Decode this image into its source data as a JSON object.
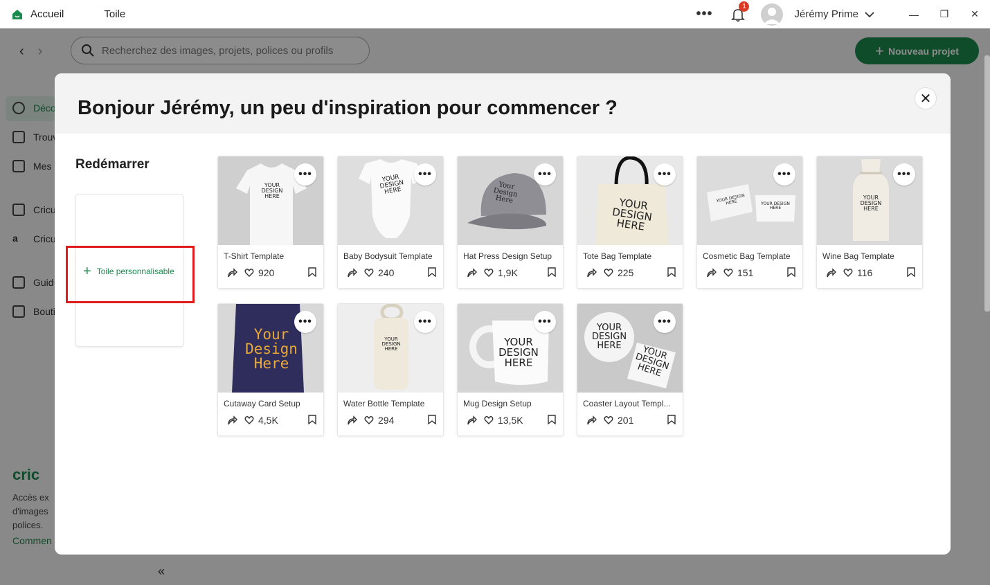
{
  "titlebar": {
    "tabs": [
      {
        "label": "Accueil",
        "active": true
      },
      {
        "label": "Toile",
        "active": false
      }
    ],
    "more_label": "•••",
    "notification_count": "1",
    "user_name": "Jérémy Prime",
    "window_buttons": [
      "—",
      "❐",
      "✕"
    ]
  },
  "app": {
    "search_placeholder": "Recherchez des images, projets, polices ou profils",
    "new_project_label": "Nouveau projet",
    "sidebar": [
      {
        "label": "Déco",
        "icon": "lightbulb-icon"
      },
      {
        "label": "Trouv",
        "icon": "rocket-icon"
      },
      {
        "label": "Mes p",
        "icon": "mail-icon"
      },
      {
        "label": "Cricu",
        "icon": "list-icon"
      },
      {
        "label": "Cricu",
        "icon": "a-icon"
      },
      {
        "label": "Guid",
        "icon": "waves-icon"
      },
      {
        "label": "Bouti",
        "icon": "bag-icon"
      }
    ],
    "promo_logo": "cric",
    "promo_text": "Accès ex d'images polices.",
    "promo_link": "Commen",
    "collapse_label": "«"
  },
  "modal": {
    "title": "Bonjour Jérémy, un peu d'inspiration pour commencer ?",
    "close_label": "✕",
    "restart_title": "Redémarrer",
    "canvas_label": "Toile personnalisable",
    "cards": [
      {
        "title": "T-Shirt Template",
        "likes": "920",
        "mock": "YOUR\nDESIGN\nHERE"
      },
      {
        "title": "Baby Bodysuit Template",
        "likes": "240",
        "mock": "YOUR\nDESIGN\nHERE"
      },
      {
        "title": "Hat Press Design Setup",
        "likes": "1,9K",
        "mock": "Your\nDesign\nHere"
      },
      {
        "title": "Tote Bag Template",
        "likes": "225",
        "mock": "YOUR\nDESIGN\nHERE"
      },
      {
        "title": "Cosmetic Bag Template",
        "likes": "151",
        "mock": "YOUR DESIGN HERE"
      },
      {
        "title": "Wine Bag Template",
        "likes": "116",
        "mock": "YOUR\nDESIGN\nHERE"
      },
      {
        "title": "Cutaway Card Setup",
        "likes": "4,5K",
        "mock": "Your\nDesign\nHere"
      },
      {
        "title": "Water Bottle Template",
        "likes": "294",
        "mock": "YOUR\nDESIGN\nHERE"
      },
      {
        "title": "Mug Design Setup",
        "likes": "13,5K",
        "mock": "YOUR\nDESIGN\nHERE"
      },
      {
        "title": "Coaster Layout Templ...",
        "likes": "201",
        "mock": "YOUR\nDESIGN\nHERE"
      }
    ]
  },
  "colors": {
    "brand_green": "#1b8a4e",
    "highlight_red": "#e01b1b",
    "badge_red": "#d93a26"
  }
}
